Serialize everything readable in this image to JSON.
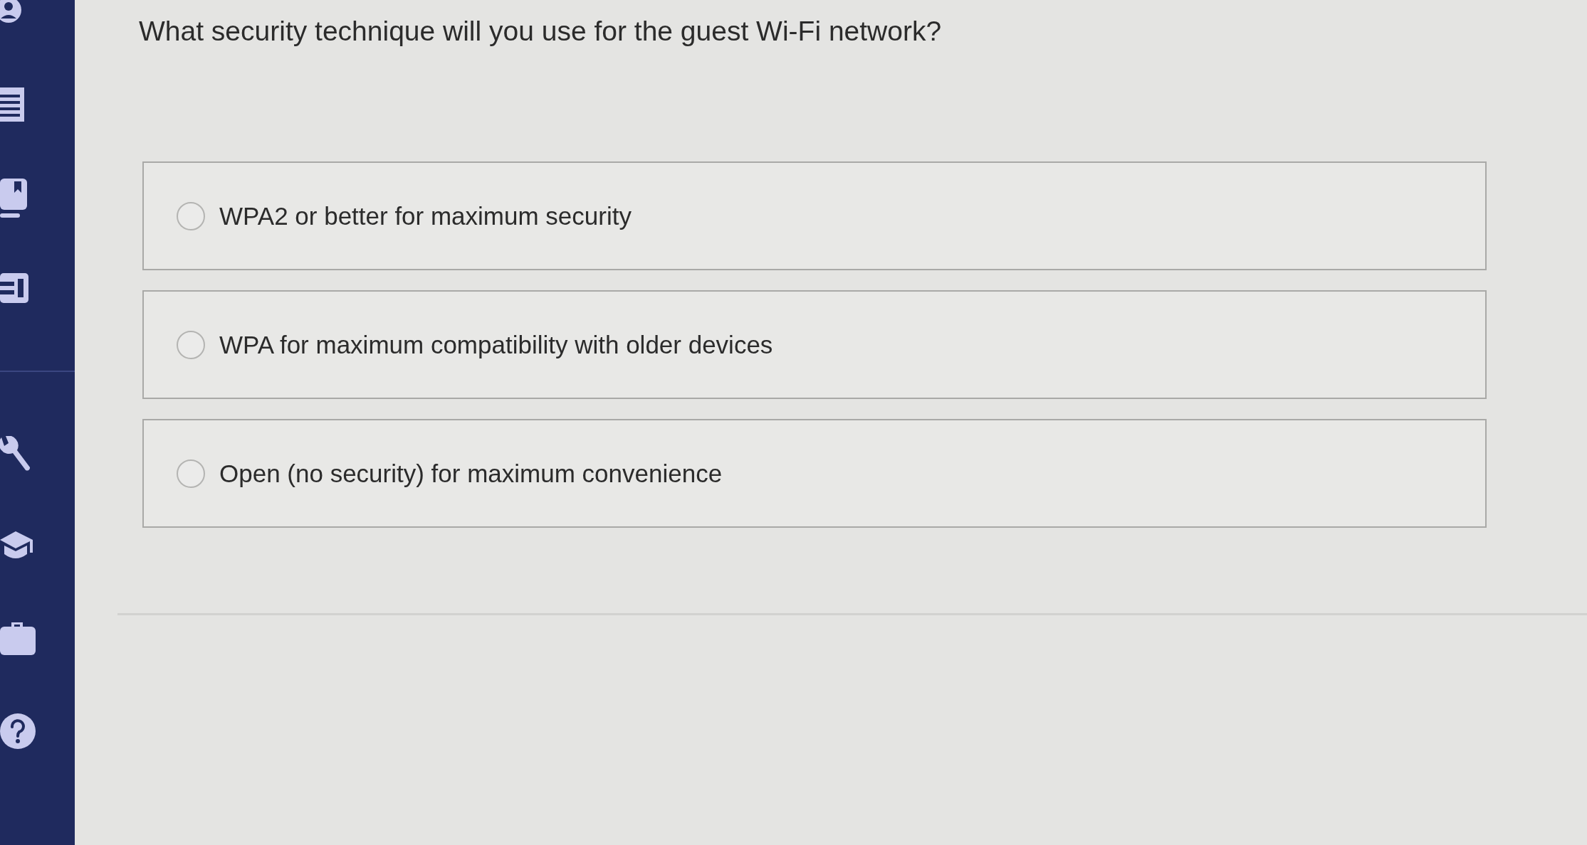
{
  "question": "What security technique will you use for the guest Wi-Fi network?",
  "options": [
    {
      "label": "WPA2 or better for maximum security",
      "selected": false
    },
    {
      "label": "WPA for maximum compatibility with older devices",
      "selected": false
    },
    {
      "label": "Open (no security) for maximum convenience",
      "selected": false
    }
  ]
}
